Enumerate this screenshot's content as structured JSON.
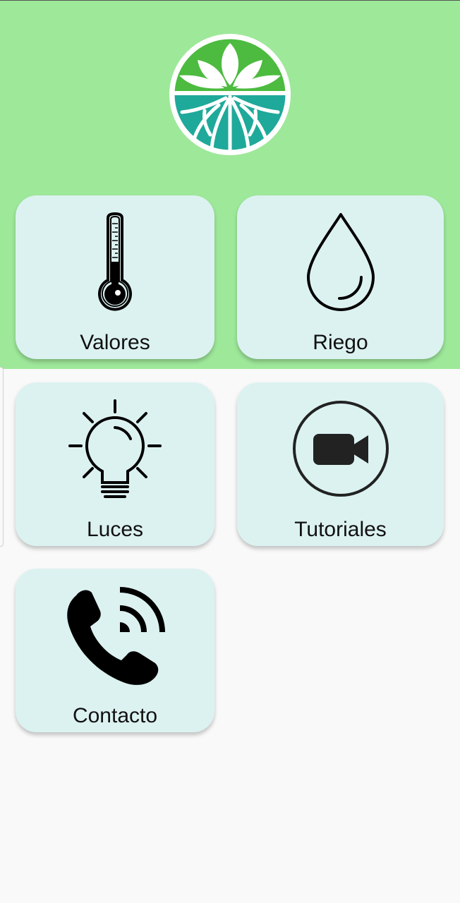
{
  "app": {
    "logo_icon": "lotus-roots-logo-icon",
    "header_color": "#9ee89a",
    "tile_color": "#dcf2f1"
  },
  "menu": {
    "items": [
      {
        "label": "Valores",
        "icon": "thermometer-icon"
      },
      {
        "label": "Riego",
        "icon": "water-drop-icon"
      },
      {
        "label": "Luces",
        "icon": "light-bulb-icon"
      },
      {
        "label": "Tutoriales",
        "icon": "video-camera-icon"
      },
      {
        "label": "Contacto",
        "icon": "phone-call-icon"
      }
    ]
  }
}
